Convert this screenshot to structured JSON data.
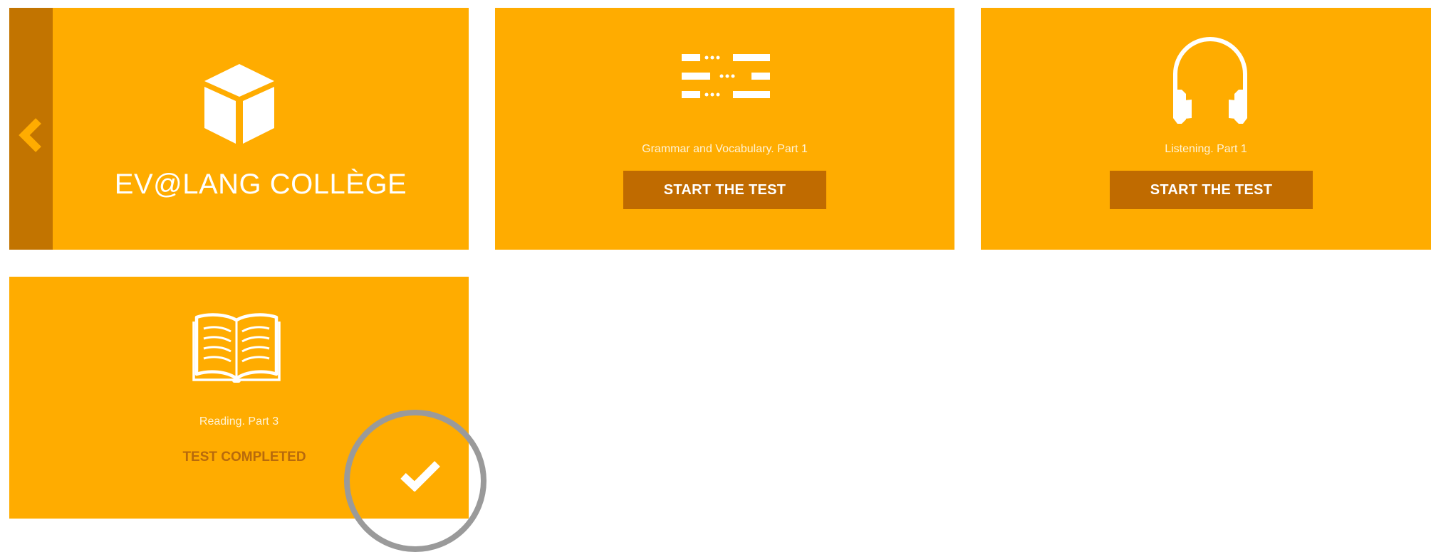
{
  "brand": {
    "title": "EV@LANG COLLÈGE",
    "icon": "cube-icon",
    "back_icon": "chevron-left-icon"
  },
  "tests": [
    {
      "caption": "Grammar and Vocabulary. Part 1",
      "icon": "list-lines-icon",
      "action_label": "START THE TEST"
    },
    {
      "caption": "Listening. Part 1",
      "icon": "headphones-icon",
      "action_label": "START THE TEST"
    },
    {
      "caption": "Reading. Part 3",
      "icon": "open-book-icon",
      "status": "TEST COMPLETED",
      "status_icon": "checkmark-icon"
    }
  ],
  "colors": {
    "tile": "#ffac00",
    "button": "#c06b00",
    "back_strip": "#c27400",
    "completed_text": "#b86a0c",
    "highlight_circle": "#9a9a9a"
  }
}
